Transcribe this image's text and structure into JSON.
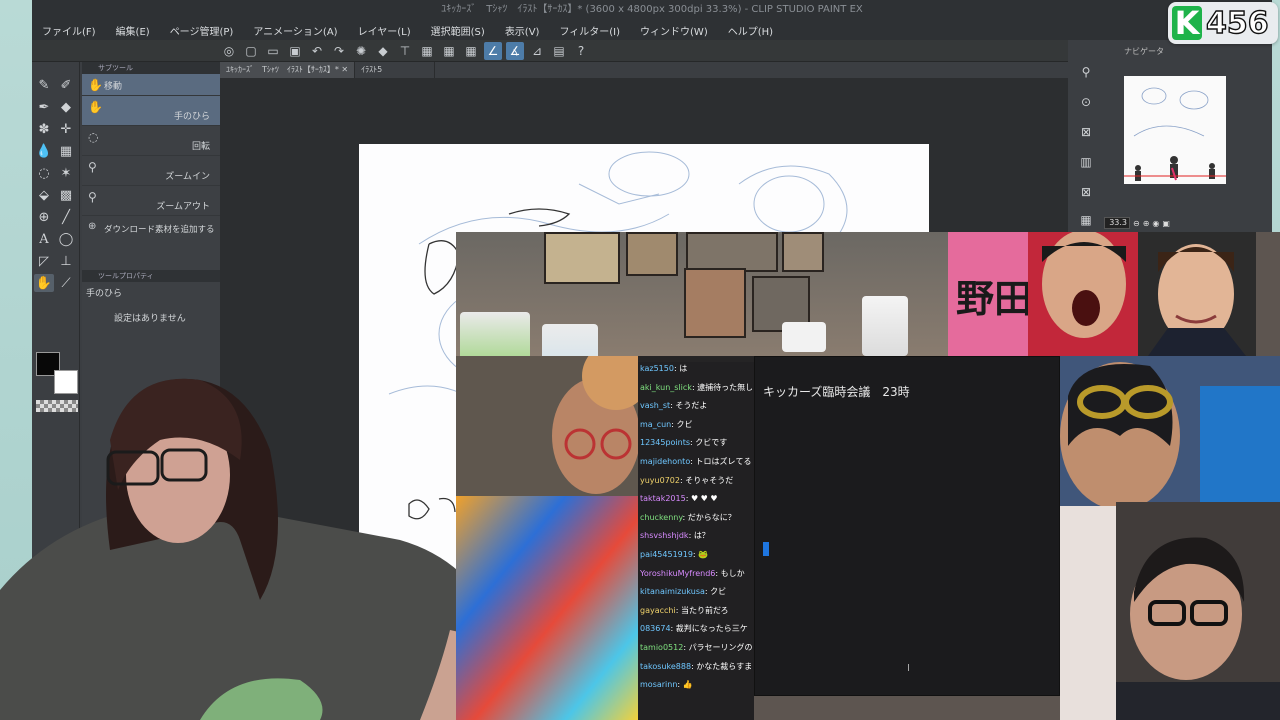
{
  "app": {
    "title": "ﾕｷｯｶｰｽﾞ　Tｼｬﾂ　ｲﾗｽﾄ【ｻｰｶｽ】* (3600 x 4800px 300dpi 33.3%) - CLIP STUDIO PAINT EX"
  },
  "menu": [
    "ファイル(F)",
    "編集(E)",
    "ページ管理(P)",
    "アニメーション(A)",
    "レイヤー(L)",
    "選択範囲(S)",
    "表示(V)",
    "フィルター(I)",
    "ウィンドウ(W)",
    "ヘルプ(H)"
  ],
  "subtool": {
    "header": "サブツール",
    "items": [
      {
        "icon": "hand-icon",
        "label": "移動"
      },
      {
        "icon": "hand-icon",
        "label": "手のひら"
      },
      {
        "icon": "rotate-icon",
        "label": "回転"
      },
      {
        "icon": "zoom-in-icon",
        "label": "ズームイン"
      },
      {
        "icon": "zoom-out-icon",
        "label": "ズームアウト"
      }
    ],
    "add_material": "ダウンロード素材を追加する"
  },
  "tool_property": {
    "header": "ツールプロパティ",
    "tool_name": "手のひら",
    "empty_msg": "設定はありません"
  },
  "tabs": [
    {
      "label": "ﾕｷｯｶｰｽﾞ　Tｼｬﾂ　ｲﾗｽﾄ【ｻｰｶｽ】*"
    },
    {
      "label": "ｲﾗｽﾄ5"
    }
  ],
  "navigator": {
    "header": "ナビゲータ",
    "zoom": "33.3"
  },
  "badge": {
    "letter": "K",
    "count": "456"
  },
  "chat": [
    {
      "user": "kaz5150",
      "msg": "は",
      "c": ""
    },
    {
      "user": "aki_kun_slick",
      "msg": "逮捕待った無し",
      "c": "g"
    },
    {
      "user": "vash_st",
      "msg": "そうだよ",
      "c": ""
    },
    {
      "user": "ma_cun",
      "msg": "クビ",
      "c": ""
    },
    {
      "user": "12345points",
      "msg": "クビです",
      "c": ""
    },
    {
      "user": "majidehonto",
      "msg": "トロはズレてる",
      "c": ""
    },
    {
      "user": "yuyu0702",
      "msg": "そりゃそうだ",
      "c": "y"
    },
    {
      "user": "taktak2015",
      "msg": "♥ ♥ ♥",
      "c": "p"
    },
    {
      "user": "chuckenny",
      "msg": "だからなに？",
      "c": "g"
    },
    {
      "user": "shsvshshjdk",
      "msg": "は？",
      "c": "p"
    },
    {
      "user": "pai45451919",
      "msg": "🐸",
      "c": ""
    },
    {
      "user": "YoroshikuMyfrend6",
      "msg": "もしか",
      "c": "p"
    },
    {
      "user": "kitanaimizukusa",
      "msg": "クビ",
      "c": ""
    },
    {
      "user": "gayacchi",
      "msg": "当たり前だろ",
      "c": "y"
    },
    {
      "user": "083674",
      "msg": "裁判になったら三ケ",
      "c": ""
    },
    {
      "user": "tamio0512",
      "msg": "パラセーリングの",
      "c": "g"
    },
    {
      "user": "takosuke888",
      "msg": "かなた裁らすま",
      "c": ""
    },
    {
      "user": "mosarinn",
      "msg": "👍",
      "c": ""
    }
  ],
  "meeting": {
    "title": "キッカーズ臨時会議　23時"
  },
  "banner": {
    "text": "野田"
  }
}
